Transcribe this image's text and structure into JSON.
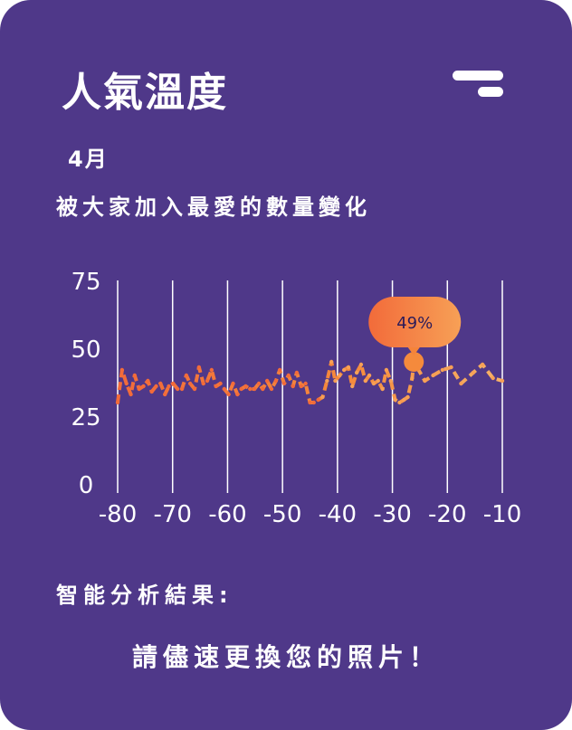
{
  "header": {
    "title": "人氣溫度",
    "month": "4月",
    "subtitle": "被大家加入最愛的數量變化"
  },
  "analysis": {
    "label": "智能分析結果:",
    "result": "請儘速更換您的照片！"
  },
  "colors": {
    "background": "#4F3889",
    "line_start": "#F26B3A",
    "line_end": "#F7B267",
    "tooltip": "#F58A3C",
    "text": "#FFFFFF"
  },
  "chart_data": {
    "type": "line",
    "x_ticks": [
      -80,
      -70,
      -60,
      -50,
      -40,
      -30,
      -20,
      -10
    ],
    "y_ticks": [
      0,
      25,
      50,
      75
    ],
    "xlim": [
      -80,
      -10
    ],
    "ylim": [
      0,
      75
    ],
    "grid": "vertical",
    "highlight": {
      "x": -26.1,
      "y": 45,
      "label": "49%"
    },
    "x": [
      -80,
      -79.2,
      -78.4,
      -77.6,
      -76.9,
      -76.1,
      -75.3,
      -74.5,
      -73.8,
      -73,
      -72.2,
      -71.4,
      -70.7,
      -69.9,
      -69.1,
      -68.3,
      -67.5,
      -66.8,
      -66,
      -65.2,
      -64.4,
      -63.7,
      -62.9,
      -62.1,
      -61.3,
      -60.6,
      -59.8,
      -59,
      -58.2,
      -57.5,
      -56.7,
      -55.9,
      -55.1,
      -54.3,
      -53.6,
      -52.8,
      -52,
      -51.2,
      -50.5,
      -49.7,
      -48.9,
      -48.1,
      -47.4,
      -46.6,
      -45.8,
      -45,
      -44.3,
      -43.5,
      -42.7,
      -41.9,
      -41.1,
      -40.4,
      -39.6,
      -38.8,
      -38,
      -37.3,
      -36.5,
      -35.7,
      -34.9,
      -34.2,
      -33.4,
      -32.6,
      -31.8,
      -31.1,
      -30.3,
      -29.5,
      -28.7,
      -27.9,
      -27.2,
      -26.4,
      -26.1,
      -24.1,
      -22.6,
      -20.9,
      -19.3,
      -17.5,
      -15.3,
      -13.6,
      -11.7,
      -10
    ],
    "y": [
      30,
      42,
      37,
      33,
      40,
      35,
      36,
      38,
      34,
      36,
      37,
      33,
      36,
      37,
      35,
      35,
      40,
      37,
      35,
      43,
      37,
      38,
      42,
      36,
      37,
      35,
      33,
      37,
      33,
      35,
      36,
      35,
      35,
      37,
      35,
      38,
      35,
      38,
      42,
      37,
      40,
      36,
      41,
      36,
      37,
      30,
      30,
      31,
      32,
      38,
      45,
      38,
      40,
      42,
      43,
      36,
      41,
      44,
      38,
      40,
      37,
      38,
      35,
      42,
      38,
      31,
      30,
      31,
      32,
      39,
      45,
      38,
      40,
      42,
      43,
      37,
      41,
      44,
      39,
      38
    ]
  }
}
